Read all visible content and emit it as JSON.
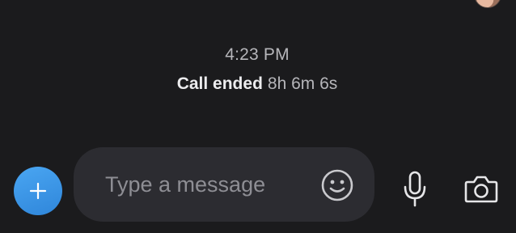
{
  "chat": {
    "timestamp": "4:23 PM",
    "call_event": {
      "title": "Call ended",
      "duration": "8h 6m 6s"
    }
  },
  "composer": {
    "value": "",
    "placeholder": "Type a message"
  },
  "icons": {
    "add": "plus-icon",
    "emoji": "smiley-icon",
    "voice": "microphone-icon",
    "camera": "camera-icon",
    "avatar": "user-avatar"
  },
  "colors": {
    "background": "#1b1b1d",
    "composer_background": "#2c2c31",
    "accent": "#3a94e6",
    "muted_text": "#b6b6ba",
    "primary_text": "#ececee",
    "placeholder_text": "#8e8e94"
  }
}
